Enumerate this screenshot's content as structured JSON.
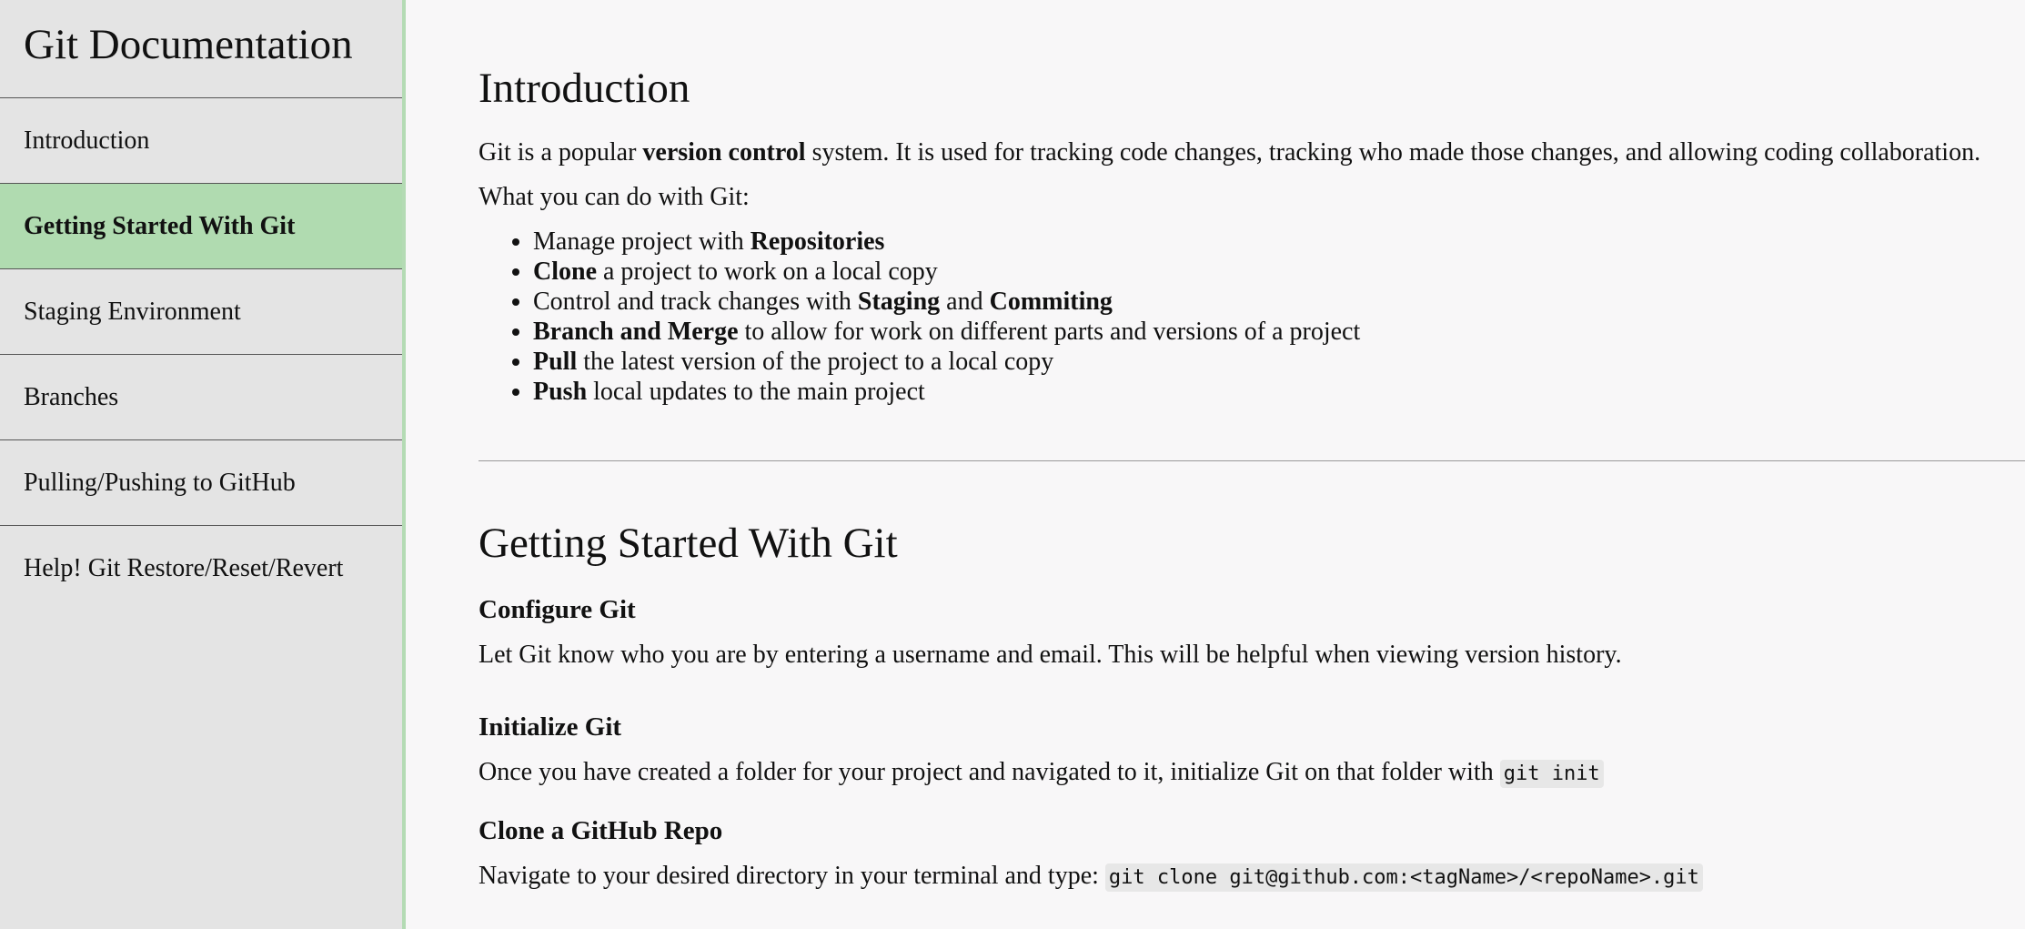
{
  "sidebar": {
    "title": "Git Documentation",
    "items": [
      {
        "label": "Introduction"
      },
      {
        "label": "Getting Started With Git"
      },
      {
        "label": "Staging Environment"
      },
      {
        "label": "Branches"
      },
      {
        "label": "Pulling/Pushing to GitHub"
      },
      {
        "label": "Help! Git Restore/Reset/Revert"
      }
    ]
  },
  "intro": {
    "title": "Introduction",
    "p1_a": "Git is a popular ",
    "p1_bold": "version control",
    "p1_b": " system. It is used for tracking code changes, tracking who made those changes, and allowing coding collaboration.",
    "p2": "What you can do with Git:",
    "bullets": [
      {
        "a": "Manage project with ",
        "b": "Repositories"
      },
      {
        "b": "Clone",
        "c": " a project to work on a local copy"
      },
      {
        "a": "Control and track changes with ",
        "b": "Staging",
        "c": " and ",
        "d": "Commiting"
      },
      {
        "b": "Branch and Merge",
        "c": " to allow for work on different parts and versions of a project"
      },
      {
        "b": "Pull",
        "c": " the latest version of the project to a local copy"
      },
      {
        "b": "Push",
        "c": " local updates to the main project"
      }
    ]
  },
  "getting_started": {
    "title": "Getting Started With Git",
    "configure_title": "Configure Git",
    "configure_text": "Let Git know who you are by entering a username and email. This will be helpful when viewing version history.",
    "init_title": "Initialize Git",
    "init_text": "Once you have created a folder for your project and navigated to it, initialize Git on that folder with ",
    "init_code": "git init",
    "clone_title": "Clone a GitHub Repo",
    "clone_text": "Navigate to your desired directory in your terminal and type: ",
    "clone_code": "git clone git@github.com:<tagName>/<repoName>.git"
  }
}
